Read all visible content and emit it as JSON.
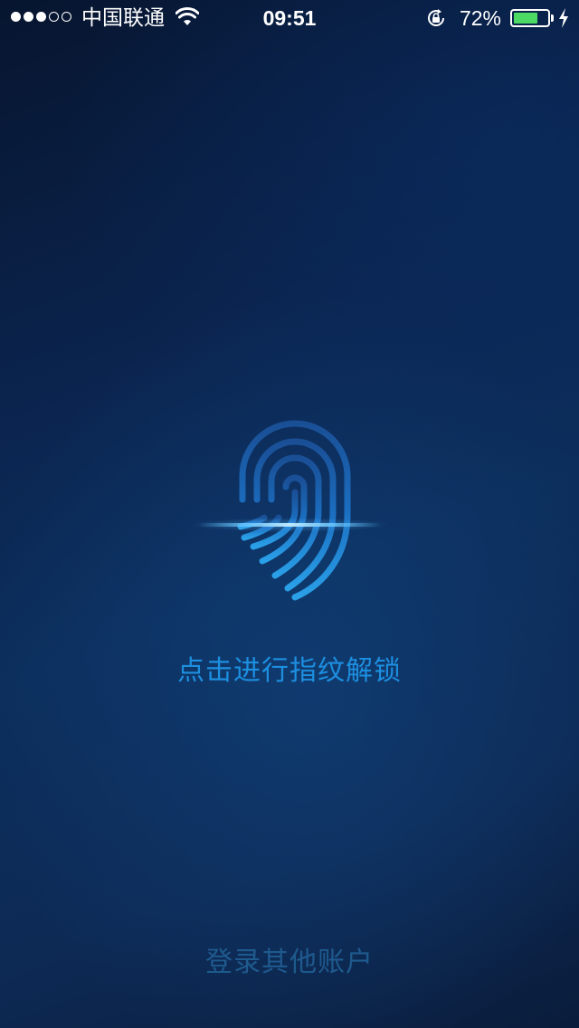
{
  "status_bar": {
    "signal_bars_filled": 3,
    "signal_bars_total": 5,
    "carrier": "中国联通",
    "time": "09:51",
    "battery_percent_label": "72%",
    "battery_level": 0.72,
    "icons": [
      "signal-dots-icon",
      "wifi-icon",
      "rotation-lock-icon",
      "battery-icon",
      "charging-bolt-icon"
    ]
  },
  "main": {
    "fingerprint_icon": "fingerprint-icon",
    "prompt": "点击进行指纹解锁",
    "other_account": "登录其他账户"
  },
  "colors": {
    "accent": "#1d8fe0",
    "secondary_link": "#1f5a8e",
    "battery_fill": "#4cd964",
    "background_dark": "#07152f",
    "background_mid": "#0c2e5c"
  }
}
